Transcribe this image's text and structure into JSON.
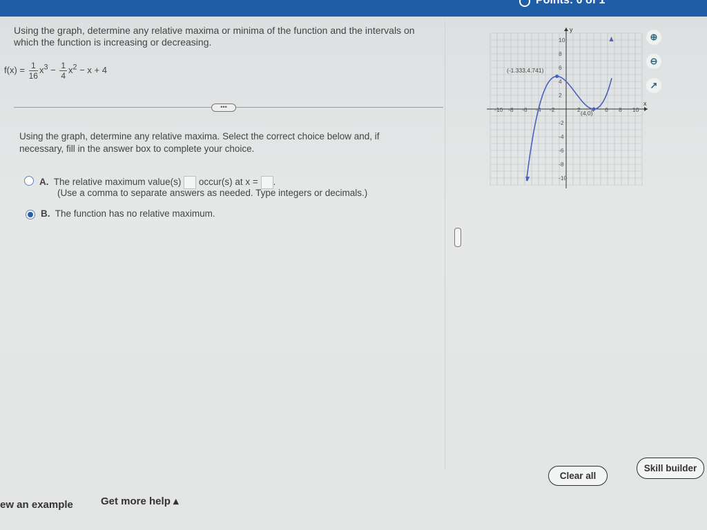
{
  "header": {
    "points_text": "Points: 0 of 1"
  },
  "question": {
    "text": "Using the graph, determine any relative maxima or minima of the function and the intervals on which the function is increasing or decreasing.",
    "formula_lhs": "f(x) =",
    "term1_num": "1",
    "term1_den": "16",
    "term1_var": "x",
    "term1_exp": "3",
    "term1_op": "−",
    "term2_num": "1",
    "term2_den": "4",
    "term2_var": "x",
    "term2_exp": "2",
    "term_rest": "− x + 4"
  },
  "expand_label": "•••",
  "prompt": "Using the graph, determine any relative maxima. Select the correct choice below and, if necessary, fill in the answer box to complete your choice.",
  "choices": [
    {
      "letter": "A.",
      "text_before": "The relative maximum value(s)",
      "text_middle": "occur(s) at x =",
      "text_end": ".",
      "note": "(Use a comma to separate answers as needed. Type integers or decimals.)",
      "selected": false
    },
    {
      "letter": "B.",
      "text": "The function has no relative maximum.",
      "selected": true
    }
  ],
  "graph": {
    "y_axis_label": "y",
    "x_axis_label": "x",
    "x_tick_labels": [
      "-10",
      "-8",
      "-6",
      "-4",
      "-2",
      "2",
      "4",
      "6",
      "8",
      "10"
    ],
    "y_tick_labels": [
      "10",
      "8",
      "6",
      "4",
      "2",
      "-2",
      "-4",
      "-6",
      "-8",
      "-10"
    ],
    "max_point_label": "(-1.333,4.741)",
    "min_point_label": "(4,0)",
    "curve_color": "#4a5fc0",
    "points": [
      {
        "x": -1.333,
        "y": 4.741
      },
      {
        "x": 4,
        "y": 0
      }
    ]
  },
  "tools": {
    "zoom_in": "zoom-in-icon",
    "zoom_out": "zoom-out-icon",
    "popout": "popout-icon"
  },
  "buttons": {
    "clear_all": "Clear all",
    "skill_builder": "Skill builder"
  },
  "footer": {
    "view_example": "ew an example",
    "more_help": "Get more help ▴"
  }
}
